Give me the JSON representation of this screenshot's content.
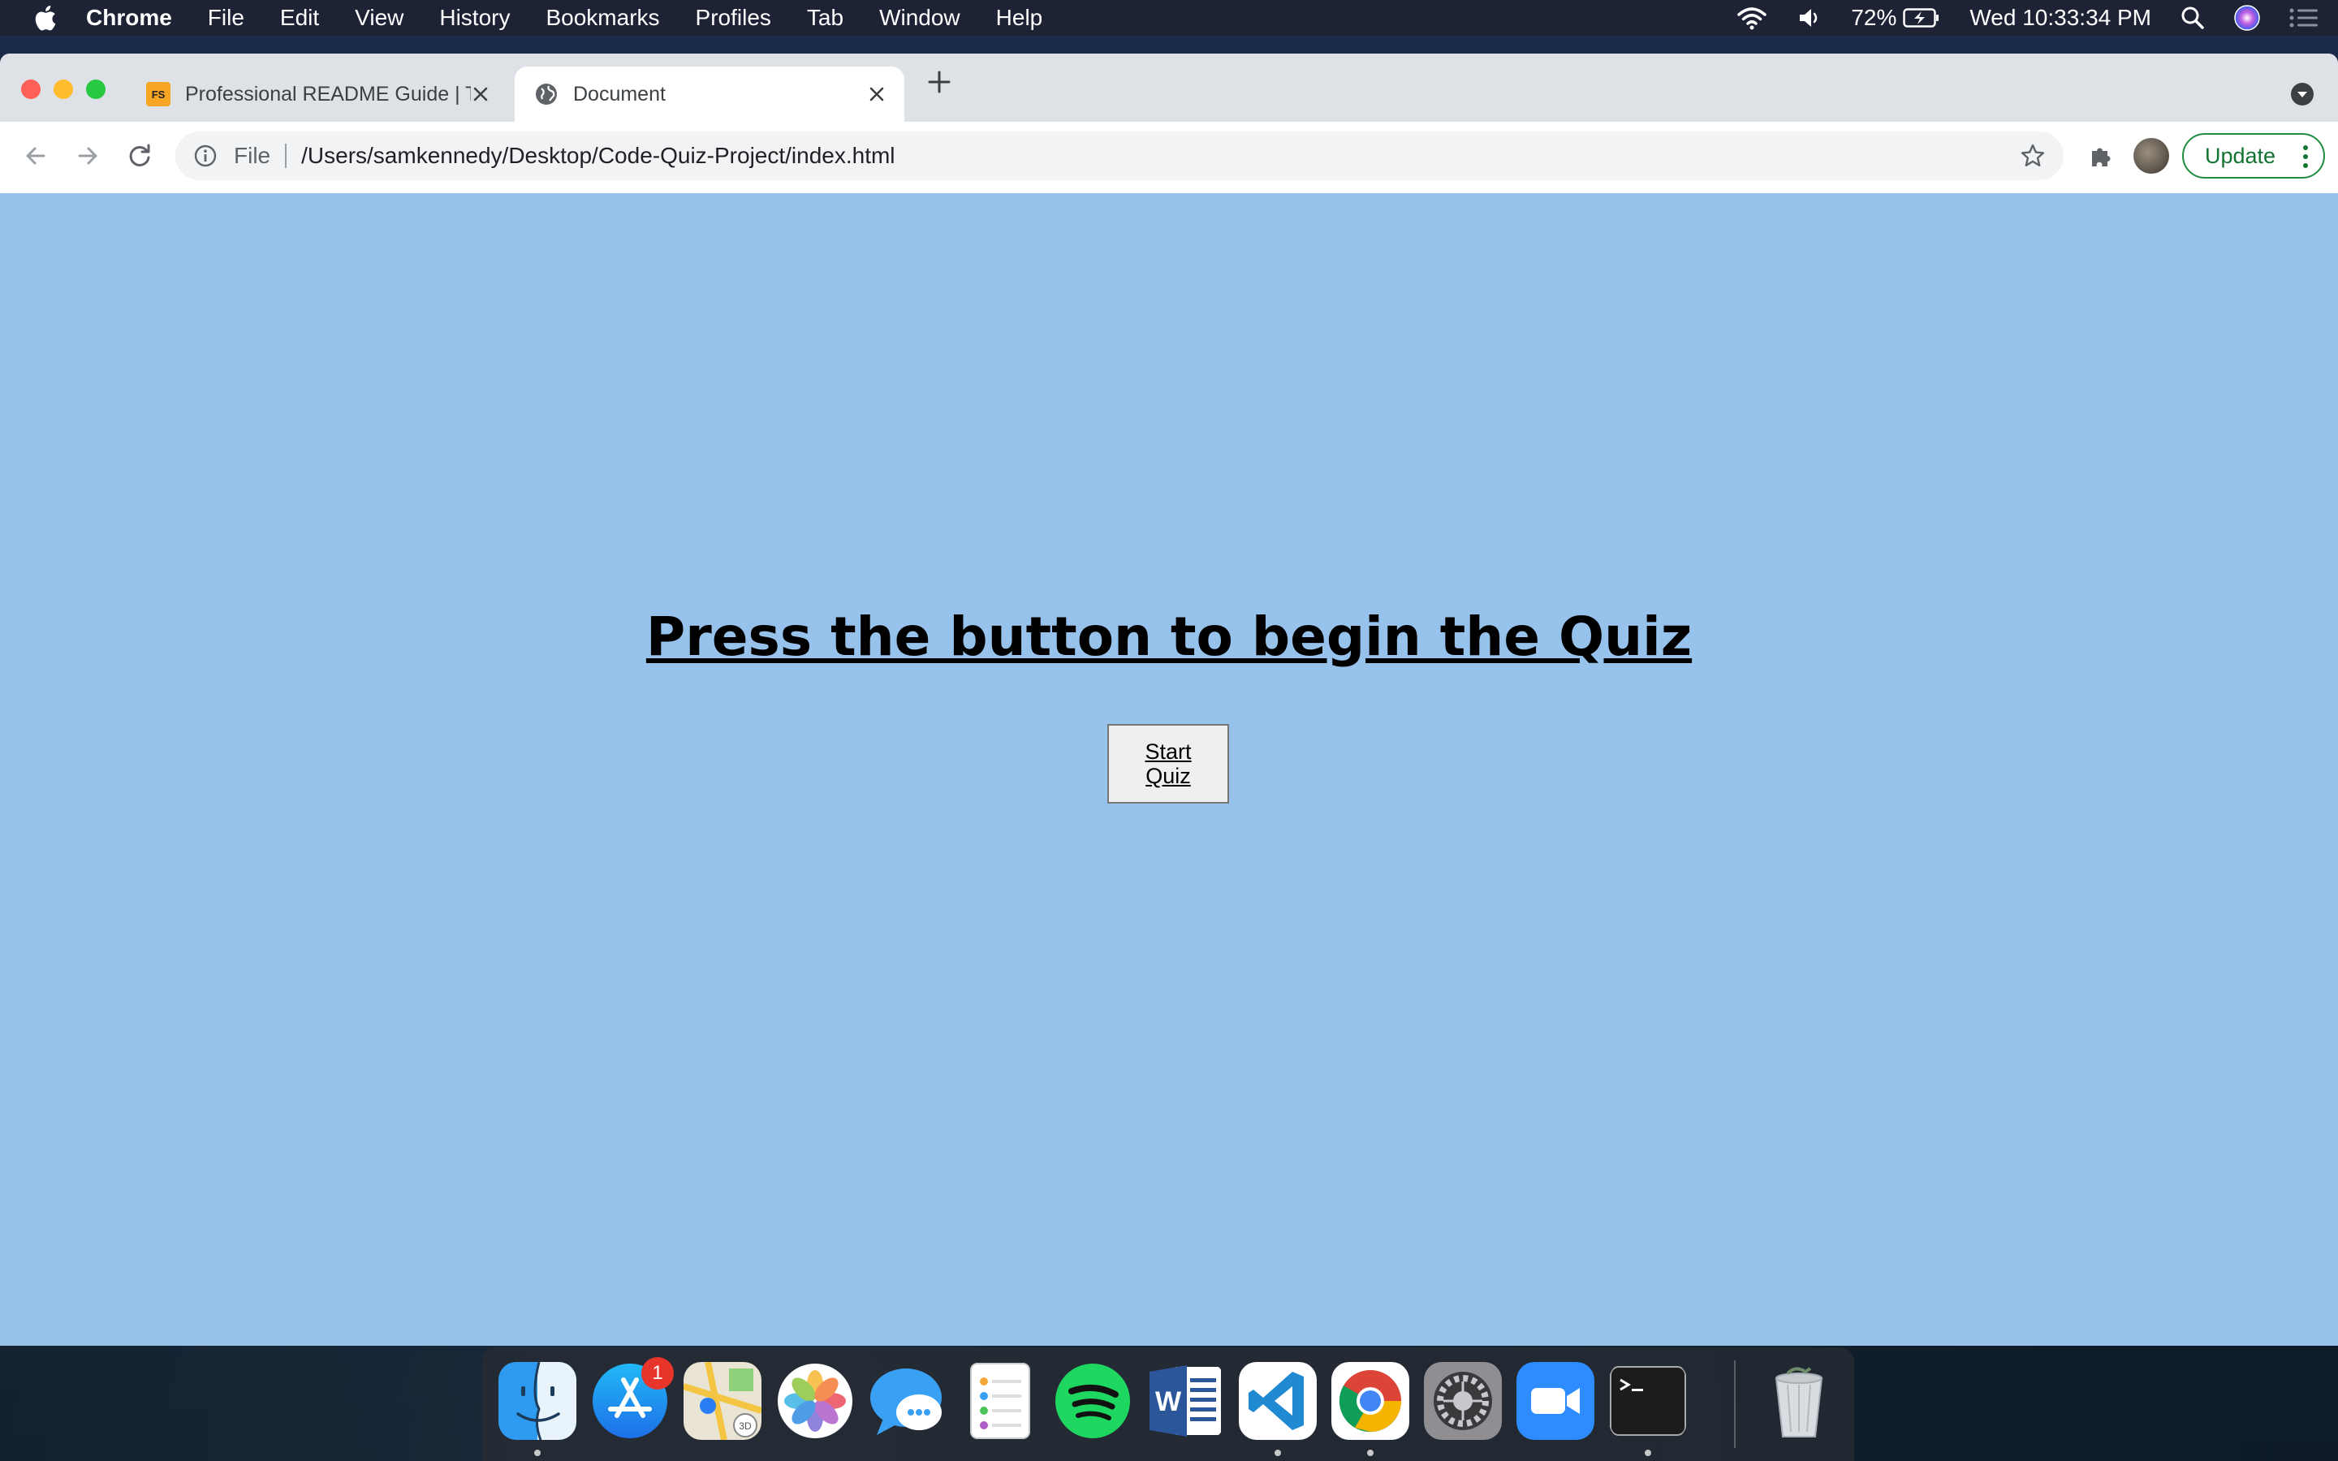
{
  "menubar": {
    "app_name": "Chrome",
    "items": [
      "File",
      "Edit",
      "View",
      "History",
      "Bookmarks",
      "Profiles",
      "Tab",
      "Window",
      "Help"
    ],
    "battery": "72%",
    "clock": "Wed 10:33:34 PM"
  },
  "browser": {
    "tabs": [
      {
        "title": "Professional README Guide | T",
        "favicon_text": "FS",
        "active": false
      },
      {
        "title": "Document",
        "active": true
      }
    ],
    "address": {
      "scheme_label": "File",
      "url": "/Users/samkennedy/Desktop/Code-Quiz-Project/index.html"
    },
    "update_label": "Update"
  },
  "page": {
    "heading": "Press the button to begin the Quiz",
    "start_button": "Start Quiz",
    "background": "#97c2ec"
  },
  "dock": {
    "apps": [
      "Finder",
      "App Store",
      "Maps",
      "Photos",
      "Messages",
      "Reminders",
      "Spotify",
      "Microsoft Word",
      "Visual Studio Code",
      "Google Chrome",
      "System Preferences",
      "Zoom",
      "Terminal",
      "Trash"
    ],
    "app_store_badge": "1"
  }
}
